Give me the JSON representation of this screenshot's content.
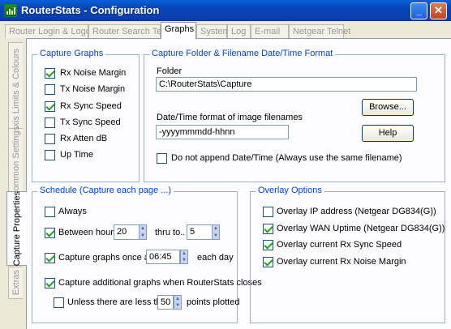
{
  "window": {
    "title": "RouterStats - Configuration",
    "minimize_glyph": "_",
    "close_glyph": "✕"
  },
  "top_tabs": [
    "Router Login & Logout",
    "Router Search Text",
    "Graphs",
    "System",
    "Log",
    "E-mail",
    "Netgear Telnet"
  ],
  "active_top_tab": "Graphs",
  "side_tabs": [
    "Y-Axis Limits & Colours",
    "Common Settings",
    "Capture Properties",
    "Extras"
  ],
  "active_side_tab": "Capture Properties",
  "capture_graphs": {
    "legend": "Capture Graphs",
    "items": [
      {
        "label": "Rx Noise Margin",
        "checked": true
      },
      {
        "label": "Tx Noise Margin",
        "checked": false
      },
      {
        "label": "Rx Sync Speed",
        "checked": true
      },
      {
        "label": "Tx Sync Speed",
        "checked": false
      },
      {
        "label": "Rx Atten dB",
        "checked": false
      },
      {
        "label": "Up Time",
        "checked": false
      }
    ]
  },
  "capture_folder": {
    "legend": "Capture  Folder & Filename Date/Time Format",
    "folder_label": "Folder",
    "folder_value": "C:\\RouterStats\\Capture",
    "browse_button": "Browse...",
    "datetime_label": "Date/Time format of image filenames",
    "datetime_value": "-yyyymmmdd-hhnn",
    "help_button": "Help",
    "no_append_label": "Do not append Date/Time (Always use the same filename)",
    "no_append_checked": false
  },
  "schedule": {
    "legend": "Schedule (Capture each page ...)",
    "always_label": "Always",
    "always_checked": false,
    "between_label": "Between hours",
    "between_checked": true,
    "from_hour": "20",
    "thru_label": "thru to..",
    "to_hour": "5",
    "once_label": "Capture graphs once at",
    "once_checked": true,
    "once_time": "06:45",
    "each_day_label": "each day",
    "additional_label": "Capture additional graphs when RouterStats closes",
    "additional_checked": true,
    "unless_label": "Unless there are less than",
    "unless_checked": false,
    "unless_value": "50",
    "points_label": "points  plotted"
  },
  "overlay": {
    "legend": "Overlay Options",
    "items": [
      {
        "label": "Overlay IP address (Netgear DG834(G))",
        "checked": false
      },
      {
        "label": "Overlay WAN Uptime (Netgear DG834(G))",
        "checked": true
      },
      {
        "label": "Overlay current Rx Sync Speed",
        "checked": true
      },
      {
        "label": "Overlay current Rx Noise Margin",
        "checked": true
      }
    ]
  },
  "colors": {
    "title_bar": "#0843b8",
    "group_legend": "#0046d5",
    "check_mark": "#21a121",
    "face": "#ece9d8"
  }
}
